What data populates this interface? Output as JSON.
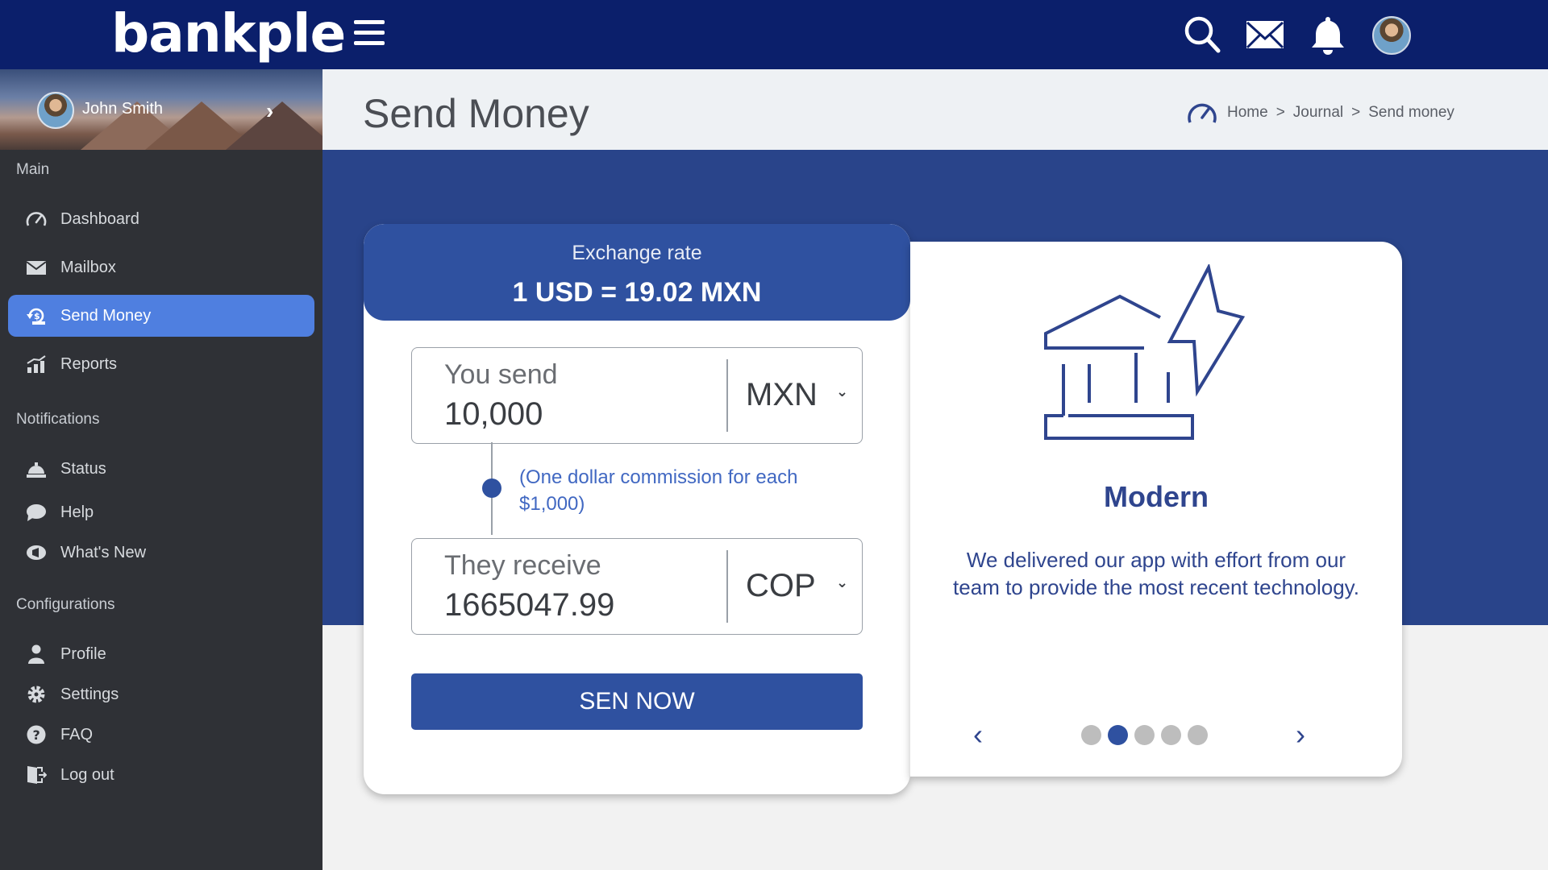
{
  "brand": {
    "logo_text": "bankple"
  },
  "topbar": {
    "icons": [
      "menu-icon",
      "search-icon",
      "mail-icon",
      "bell-icon",
      "avatar"
    ]
  },
  "sidebar": {
    "user": {
      "name": "John Smith"
    },
    "sections": {
      "main": "Main",
      "notifications": "Notifications",
      "configurations": "Configurations"
    },
    "items": [
      {
        "label": "Dashboard",
        "icon": "gauge-icon",
        "active": false
      },
      {
        "label": "Mailbox",
        "icon": "mail-icon",
        "active": false
      },
      {
        "label": "Send Money",
        "icon": "money-transfer-icon",
        "active": true
      },
      {
        "label": "Reports",
        "icon": "chart-icon",
        "active": false
      },
      {
        "label": "Status",
        "icon": "bell-desk-icon",
        "active": false
      },
      {
        "label": "Help",
        "icon": "chat-bubble-icon",
        "active": false
      },
      {
        "label": "What's New",
        "icon": "megaphone-icon",
        "active": false
      },
      {
        "label": "Profile",
        "icon": "user-icon",
        "active": false
      },
      {
        "label": "Settings",
        "icon": "gear-icon",
        "active": false
      },
      {
        "label": "FAQ",
        "icon": "question-icon",
        "active": false
      },
      {
        "label": "Log out",
        "icon": "logout-icon",
        "active": false
      }
    ]
  },
  "header": {
    "title": "Send Money",
    "breadcrumb": [
      "Home",
      "Journal",
      "Send money"
    ],
    "breadcrumb_sep": ">"
  },
  "exchange": {
    "label": "Exchange rate",
    "rate": "1 USD = 19.02 MXN",
    "send": {
      "label": "You send",
      "value": "10,000",
      "currency": "MXN"
    },
    "commission": "(One dollar commission for each $1,000)",
    "receive": {
      "label": "They receive",
      "value": "1665047.99",
      "currency": "COP"
    },
    "button": "SEN NOW"
  },
  "feature": {
    "icon": "bank-lightning-icon",
    "title": "Modern",
    "description": "We delivered our app with effort from our team to provide the most recent technology.",
    "carousel": {
      "total": 5,
      "active_index": 1
    }
  },
  "colors": {
    "topbar": "#0b1f6b",
    "sidebar": "#2f3136",
    "accent": "#4f7fe0",
    "primary": "#2f51a0",
    "band": "#29448a"
  }
}
